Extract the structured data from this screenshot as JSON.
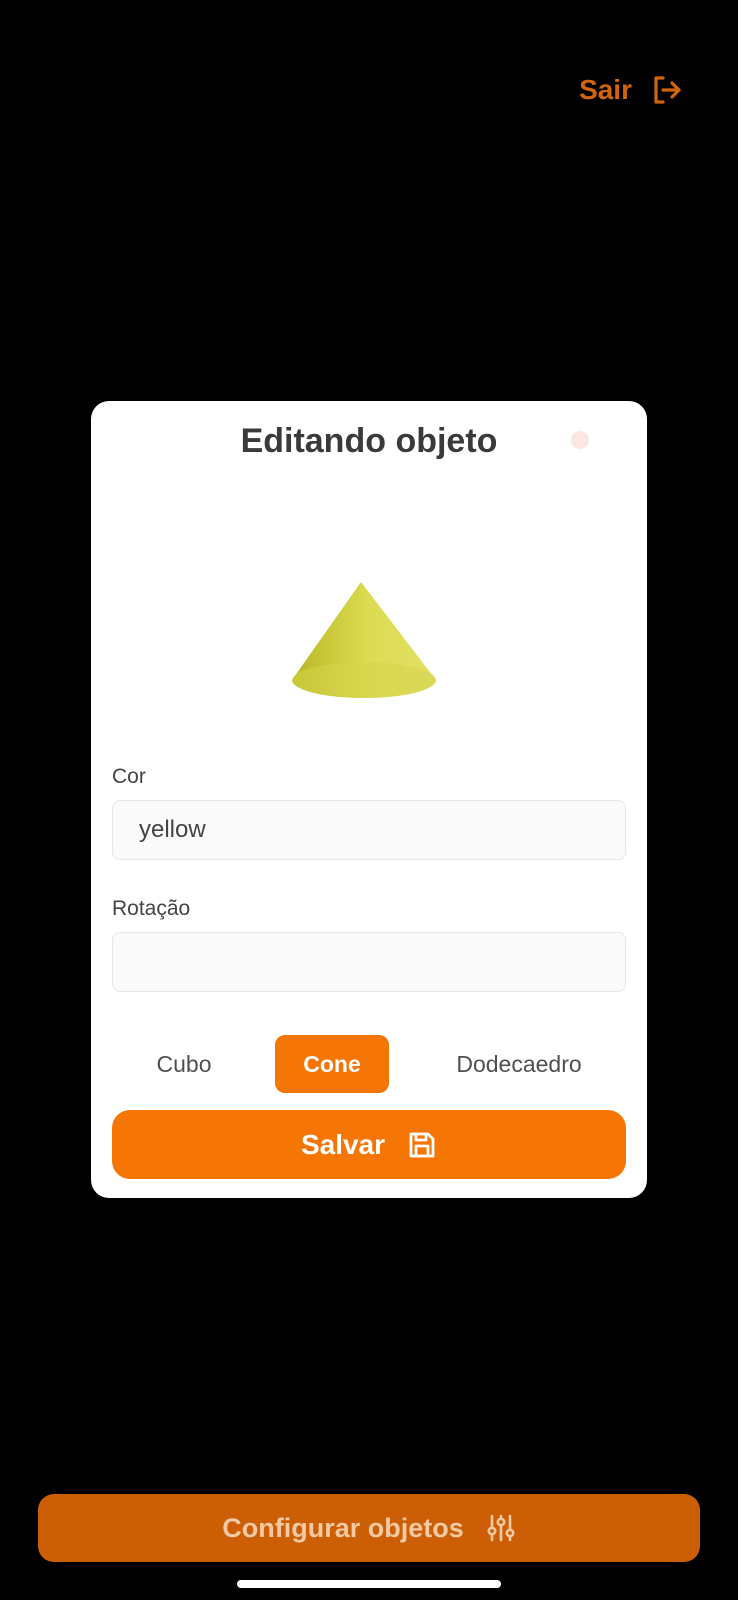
{
  "header": {
    "logout_label": "Sair",
    "logout_icon": "logout-icon"
  },
  "modal": {
    "title": "Editando objeto",
    "close_icon": "close-dot",
    "preview": {
      "shape": "Cone",
      "color": "yellow",
      "icon": "cone-3d-preview"
    },
    "color_field": {
      "label": "Cor",
      "value": "yellow",
      "placeholder": ""
    },
    "rotation_field": {
      "label": "Rotação",
      "value": "",
      "placeholder": ""
    },
    "shape_options": [
      {
        "label": "Cubo",
        "selected": false
      },
      {
        "label": "Cone",
        "selected": true
      },
      {
        "label": "Dodecaedro",
        "selected": false
      }
    ],
    "save_label": "Salvar",
    "save_icon": "save-icon"
  },
  "footer": {
    "config_label": "Configurar objetos",
    "config_icon": "sliders-icon"
  },
  "colors": {
    "background": "#000000",
    "accent": "#f57604",
    "accent_dark": "#cc5e05",
    "logout_text": "#d2650a",
    "cone_yellow": "#d8d84a"
  }
}
